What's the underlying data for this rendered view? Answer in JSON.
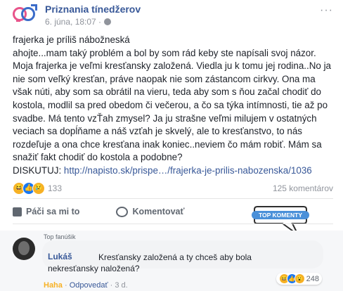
{
  "post": {
    "page_name": "Priznania tínedžerov",
    "date": "6. júna, 18:07 · ",
    "text": "frajerka je príliš nábožneská\nahojte...mam taký problém a bol by som rád keby ste napísali svoj názor. Moja frajerka je veľmi kresťansky založená. Viedla ju k tomu jej rodina..No ja nie som veľký kresťan, práve naopak nie som zástancom cirkvy. Ona ma však núti, aby som sa obrátil na vieru, teda aby som s ňou začal chodiť do kostola, modlil sa pred obedom či večerou, a čo sa týka intímnosti, tie až po svadbe. Má tento vzŤah zmysel? Ja ju strašne veľmi milujem v ostatných veciach sa dopĺňame a náš vzťah je skvelý, ale to kresťanstvo, to nás rozdeľuje a ona chce kresťana inak koniec..neviem čo mám robiť. Mám sa snažiť fakt chodiť do kostola a podobne?\nDISKUTUJ: ",
    "link_text": "http://napisto.sk/prispe…/frajerka-je-prilis-nabozenska/1036",
    "reaction_count": "133",
    "comment_count": "125 komentárov"
  },
  "actions": {
    "like": "Páči sa mi to",
    "comment": "Komentovať"
  },
  "badge": {
    "label": "TOP KOMENTY"
  },
  "comment": {
    "fan_tag": "Top fanúšik",
    "author": "Lukáš",
    "text": "Kresťansky založená a ty chceš aby bola nekresťansky naložená?",
    "reaction_count": "248",
    "haha": "Haha",
    "reply": "Odpovedať",
    "time": "3 d."
  },
  "colors": {
    "link": "#385898",
    "accent": "#1877f2"
  }
}
